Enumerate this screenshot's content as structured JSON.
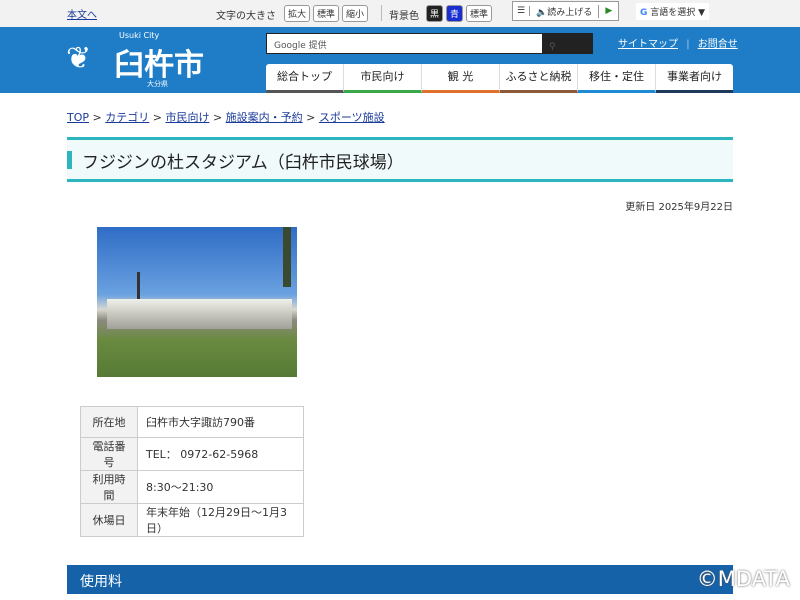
{
  "topbar": {
    "skip": "本文へ",
    "font_size_label": "文字の大きさ",
    "font_buttons": [
      "拡大",
      "標準",
      "縮小"
    ],
    "bg_label": "背景色",
    "bg_buttons": [
      "黒",
      "青",
      "標準"
    ],
    "read_aloud": "読み上げる",
    "language": "言語を選択"
  },
  "header": {
    "city_en": "Usuki City",
    "city": "臼杵市",
    "pref": "大分県",
    "search_placeholder": "Google 提供",
    "links": [
      "サイトマップ",
      "お問合せ"
    ],
    "nav": [
      {
        "label": "総合トップ",
        "color": "#555555"
      },
      {
        "label": "市民向け",
        "color": "#3aa84a"
      },
      {
        "label": "観 光",
        "color": "#e0702a"
      },
      {
        "label": "ふるさと納税",
        "color": "#8a5a3a"
      },
      {
        "label": "移住・定住",
        "color": "#1f8ad6"
      },
      {
        "label": "事業者向け",
        "color": "#1e3a5a"
      }
    ]
  },
  "breadcrumb": [
    "TOP",
    "カテゴリ",
    "市民向け",
    "施設案内・予約",
    "スポーツ施設"
  ],
  "page": {
    "title": "フジジンの杜スタジアム（臼杵市民球場）",
    "updated": "更新日 2025年9月22日",
    "info": [
      {
        "k": "所在地",
        "v": "臼杵市大字諏訪790番"
      },
      {
        "k": "電話番号",
        "v": "TEL： 0972-62-5968"
      },
      {
        "k": "利用時間",
        "v": "8:30～21:30"
      },
      {
        "k": "休場日",
        "v": "年末年始（12月29日～1月3日）"
      }
    ],
    "section": "使用料"
  },
  "watermark": "©MDATA"
}
